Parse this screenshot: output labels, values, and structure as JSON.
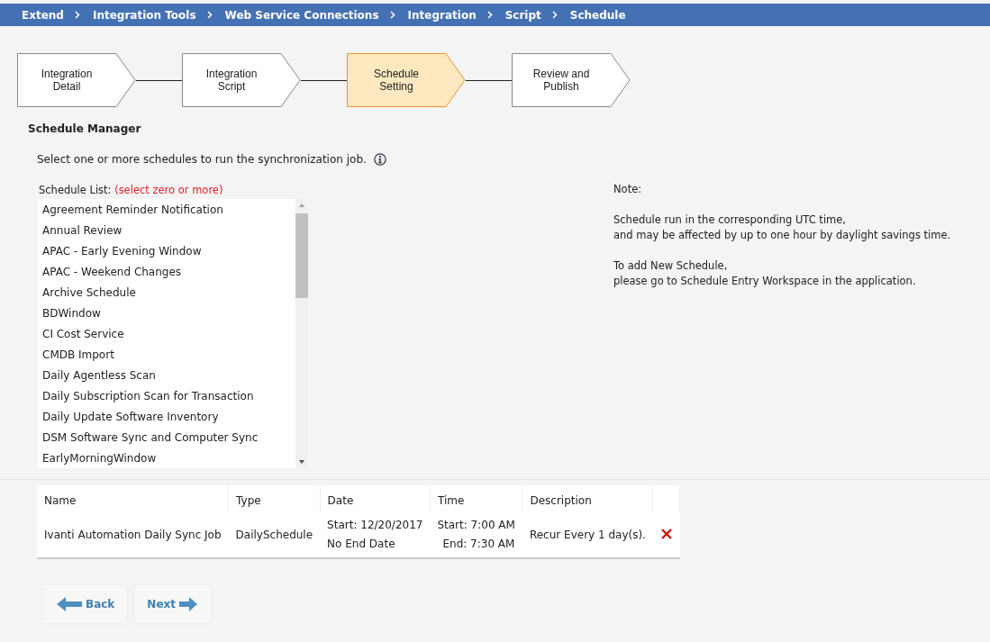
{
  "breadcrumb": [
    "Extend",
    "Integration Tools",
    "Web Service Connections",
    "Integration",
    "Script",
    "Schedule"
  ],
  "steps": [
    {
      "lines": [
        "Integration",
        "Detail"
      ],
      "selected": false
    },
    {
      "lines": [
        "Integration",
        "Script"
      ],
      "selected": false
    },
    {
      "lines": [
        "Schedule",
        "Setting"
      ],
      "selected": true
    },
    {
      "lines": [
        "Review and",
        "Publish"
      ],
      "selected": false
    }
  ],
  "section_title": "Schedule Manager",
  "instruction": "Select one or more schedules to run the synchronization job.",
  "list_label": "Schedule List:",
  "list_hint": "(select zero or more)",
  "schedules": [
    {
      "name": "Agreement Reminder Notification",
      "selected": false
    },
    {
      "name": "Annual Review",
      "selected": false
    },
    {
      "name": "APAC - Early Evening Window",
      "selected": false
    },
    {
      "name": "APAC - Weekend Changes",
      "selected": false
    },
    {
      "name": "Archive Schedule",
      "selected": false
    },
    {
      "name": "BDWindow",
      "selected": false
    },
    {
      "name": "CI Cost Service",
      "selected": false
    },
    {
      "name": "CMDB Import",
      "selected": false
    },
    {
      "name": "Daily Agentless Scan",
      "selected": false
    },
    {
      "name": "Daily Subscription Scan for Transaction",
      "selected": false
    },
    {
      "name": "Daily Update Software Inventory",
      "selected": false
    },
    {
      "name": "DSM Software Sync and Computer Sync",
      "selected": false
    },
    {
      "name": "EarlyMorningWindow",
      "selected": false
    }
  ],
  "note": {
    "title": "Note:",
    "paragraphs": [
      [
        "Schedule run in the corresponding UTC time,",
        "and may be affected by up to one hour by daylight savings time."
      ],
      [
        "To add New Schedule,",
        "please go to Schedule Entry Workspace in the application."
      ]
    ]
  },
  "table": {
    "columns": [
      "Name",
      "Type",
      "Date",
      "Time",
      "Description"
    ],
    "rows": [
      {
        "name": "Ivanti Automation Daily Sync Job",
        "type": "DailySchedule",
        "date": [
          "Start: 12/20/2017",
          "No End Date"
        ],
        "time": [
          "Start: 7:00 AM",
          "End: 7:30 AM"
        ],
        "description": "Recur Every 1 day(s)."
      }
    ]
  },
  "buttons": {
    "back": "Back",
    "next": "Next"
  }
}
